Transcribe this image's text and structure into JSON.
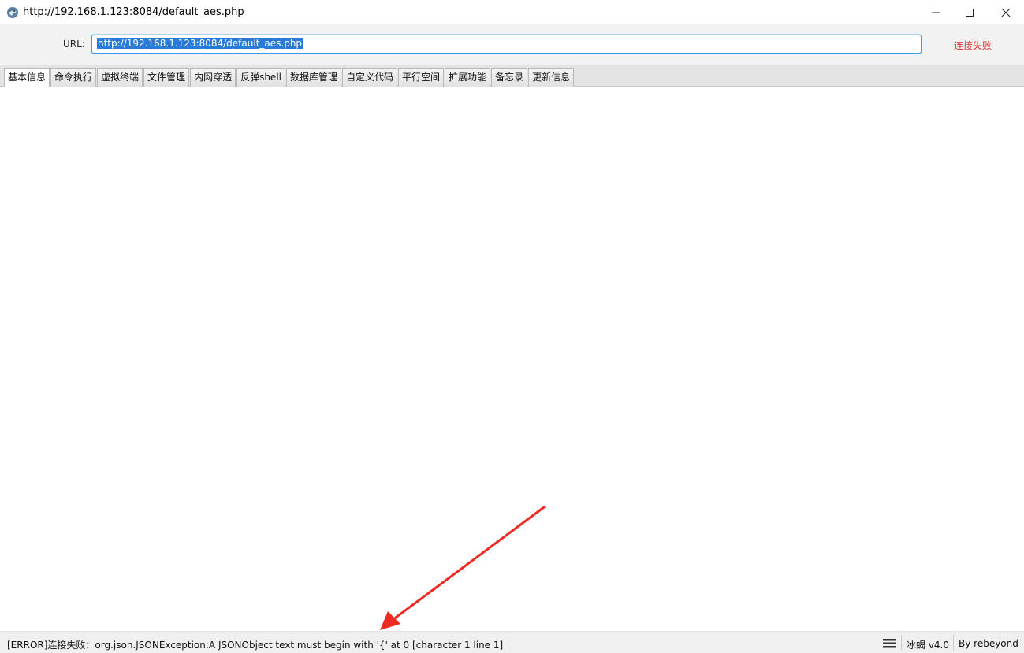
{
  "window": {
    "title": "http://192.168.1.123:8084/default_aes.php"
  },
  "urlbar": {
    "label": "URL:",
    "value": "http://192.168.1.123:8084/default_aes.php",
    "status": "连接失败"
  },
  "tabs": [
    {
      "label": "基本信息",
      "active": true
    },
    {
      "label": "命令执行"
    },
    {
      "label": "虚拟终端"
    },
    {
      "label": "文件管理"
    },
    {
      "label": "内网穿透"
    },
    {
      "label": "反弹shell"
    },
    {
      "label": "数据库管理"
    },
    {
      "label": "自定义代码"
    },
    {
      "label": "平行空间"
    },
    {
      "label": "扩展功能"
    },
    {
      "label": "备忘录"
    },
    {
      "label": "更新信息"
    }
  ],
  "statusbar": {
    "log": "[ERROR]连接失败：org.json.JSONException:A JSONObject text must begin with '{' at 0 [character 1 line 1]",
    "version": "冰蝎 v4.0",
    "author": "By rebeyond"
  },
  "colors": {
    "accent": "#2a7bd8",
    "error": "#e03131",
    "arrow": "#ee2a24"
  },
  "icons": [
    "app-icon",
    "minimize-icon",
    "maximize-icon",
    "close-icon",
    "menu-icon",
    "arrow-annotation"
  ]
}
